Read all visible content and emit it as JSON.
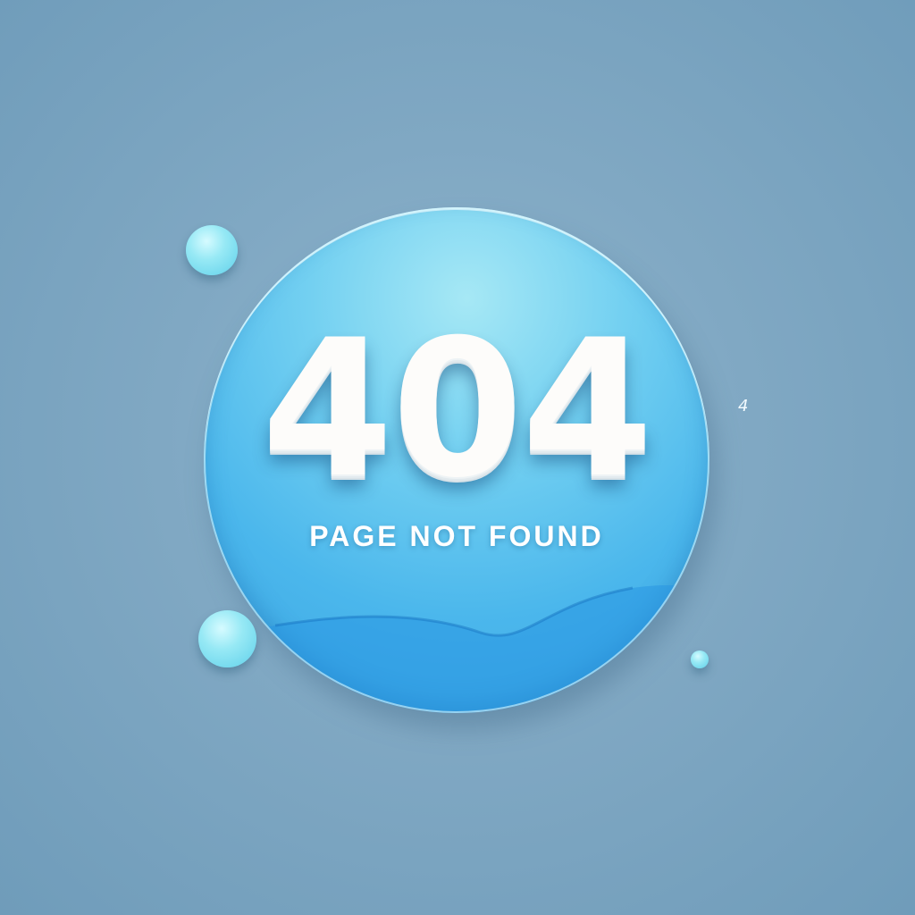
{
  "error": {
    "code": "404",
    "message": "PAGE NOT FOUND",
    "stray_glyph": "4"
  },
  "colors": {
    "background": "#80a8c3",
    "disc_light": "#a6e8f5",
    "disc_mid": "#4bb7ec",
    "disc_dark": "#3aa4e2",
    "text": "#fdfcfa",
    "bubble": "#97e9f5"
  }
}
